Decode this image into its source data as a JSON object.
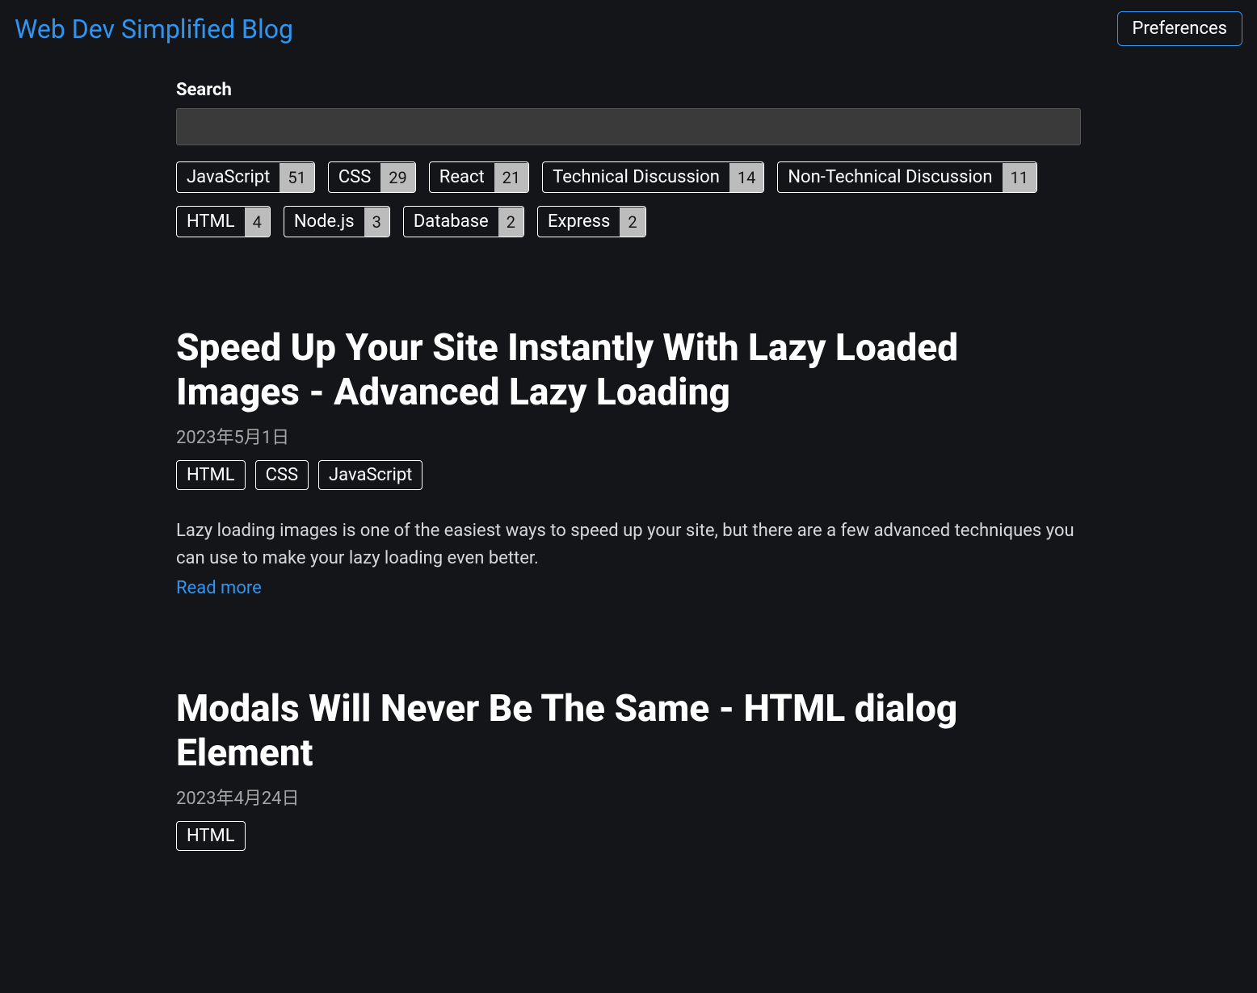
{
  "header": {
    "title": "Web Dev Simplified Blog",
    "preferences_label": "Preferences"
  },
  "search": {
    "label": "Search",
    "value": ""
  },
  "filter_tags": [
    {
      "label": "JavaScript",
      "count": "51"
    },
    {
      "label": "CSS",
      "count": "29"
    },
    {
      "label": "React",
      "count": "21"
    },
    {
      "label": "Technical Discussion",
      "count": "14"
    },
    {
      "label": "Non-Technical Discussion",
      "count": "11"
    },
    {
      "label": "HTML",
      "count": "4"
    },
    {
      "label": "Node.js",
      "count": "3"
    },
    {
      "label": "Database",
      "count": "2"
    },
    {
      "label": "Express",
      "count": "2"
    }
  ],
  "articles": [
    {
      "title": "Speed Up Your Site Instantly With Lazy Loaded Images - Advanced Lazy Loading",
      "date": "2023年5月1日",
      "tags": [
        "HTML",
        "CSS",
        "JavaScript"
      ],
      "excerpt": "Lazy loading images is one of the easiest ways to speed up your site, but there are a few advanced techniques you can use to make your lazy loading even better.",
      "read_more": "Read more"
    },
    {
      "title": "Modals Will Never Be The Same - HTML dialog Element",
      "date": "2023年4月24日",
      "tags": [
        "HTML"
      ],
      "excerpt": "",
      "read_more": ""
    }
  ]
}
